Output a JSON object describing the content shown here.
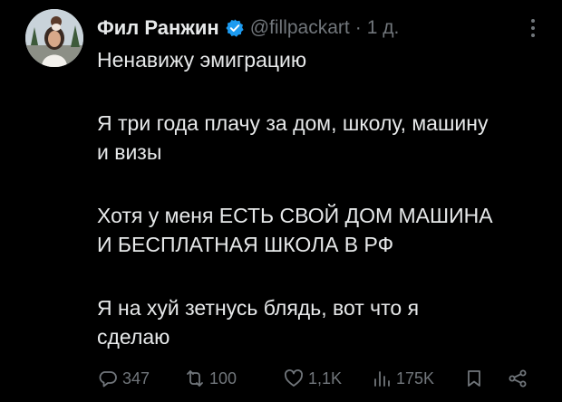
{
  "author": {
    "display_name": "Фил Ранжин",
    "handle": "@fillpackart",
    "separator": "·",
    "time": "1 д.",
    "verified": true
  },
  "tweet": {
    "lines": [
      "Ненавижу эмиграцию",
      "Я три года плачу за дом, школу, машину",
      "и визы",
      "Хотя у меня ЕСТЬ СВОЙ ДОМ МАШИНА",
      "И БЕСПЛАТНАЯ ШКОЛА В РФ",
      "Я на хуй зетнусь блядь, вот что я",
      "сделаю"
    ]
  },
  "actions": {
    "replies": "347",
    "reposts": "100",
    "likes": "1,1K",
    "views": "175K"
  },
  "icons": {
    "reply": "reply-icon",
    "repost": "repost-icon",
    "like": "like-icon",
    "views": "views-icon",
    "bookmark": "bookmark-icon",
    "share": "share-icon",
    "more": "more-icon",
    "verified": "verified-badge-icon"
  },
  "colors": {
    "background": "#000000",
    "text": "#e7e9ea",
    "muted": "#71767b",
    "verified": "#1d9bf0"
  }
}
